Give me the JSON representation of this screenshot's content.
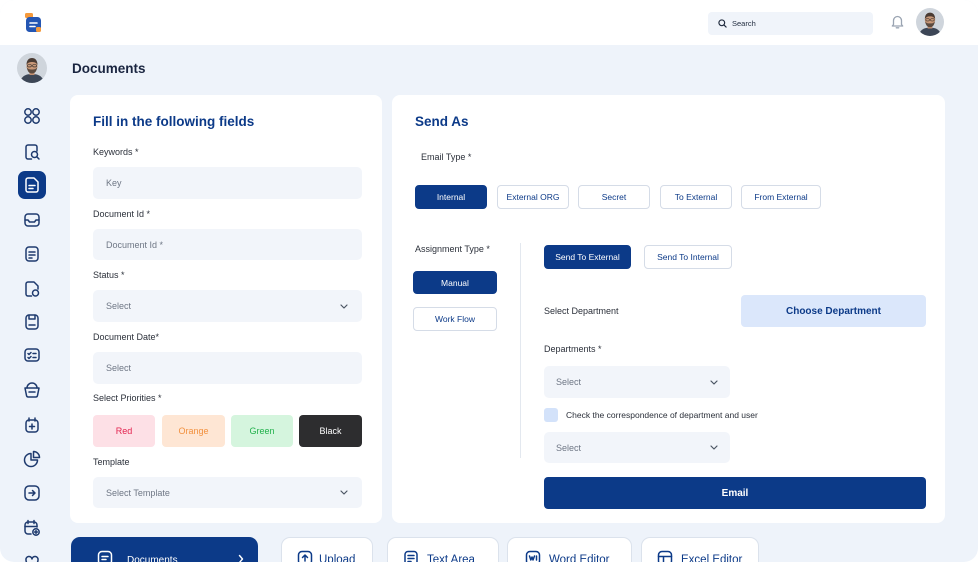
{
  "theme": {
    "primary_color": "#0c3a88",
    "page_background_color": "#eef3fa",
    "input_background_color": "#f2f5fa",
    "choose_button_color": "#dbe7fb"
  },
  "topbar": {
    "logo_icon": "app-logo-icon",
    "search": {
      "icon": "search-icon",
      "placeholder": "Search"
    },
    "notification_icon": "bell-icon"
  },
  "sidebar": {
    "items": [
      {
        "icon": "dashboard-grid-icon",
        "active": false
      },
      {
        "icon": "search-document-icon",
        "active": false
      },
      {
        "icon": "documents-icon",
        "active": true
      },
      {
        "icon": "inbox-icon",
        "active": false
      },
      {
        "icon": "notes-icon",
        "active": false
      },
      {
        "icon": "file-shapes-icon",
        "active": false
      },
      {
        "icon": "save-document-icon",
        "active": false
      },
      {
        "icon": "checklist-icon",
        "active": false
      },
      {
        "icon": "basket-icon",
        "active": false
      },
      {
        "icon": "calendar-add-icon",
        "active": false
      },
      {
        "icon": "pie-chart-icon",
        "active": false
      },
      {
        "icon": "export-icon",
        "active": false
      },
      {
        "icon": "schedule-add-icon",
        "active": false
      },
      {
        "icon": "favorites-icon",
        "active": false
      }
    ]
  },
  "page": {
    "title": "Documents"
  },
  "form_card": {
    "title": "Fill in the following fields",
    "keywords": {
      "label": "Keywords *",
      "placeholder": "Key"
    },
    "document_id": {
      "label": "Document Id *",
      "placeholder": "Document Id *"
    },
    "status": {
      "label": "Status *",
      "value": "Select"
    },
    "document_date": {
      "label": "Document Date*",
      "placeholder": "Select"
    },
    "priorities": {
      "label": "Select Priorities *",
      "options": [
        {
          "label": "Red",
          "text_color": "#e3234f",
          "background_color": "#fde0e6"
        },
        {
          "label": "Orange",
          "text_color": "#f2913f",
          "background_color": "#fee6d4"
        },
        {
          "label": "Green",
          "text_color": "#22b14c",
          "background_color": "#d5f5de"
        },
        {
          "label": "Black",
          "text_color": "#ffffff",
          "background_color": "#2d2d2f"
        }
      ]
    },
    "template": {
      "label": "Template",
      "value": "Select Template"
    }
  },
  "send_card": {
    "title": "Send As",
    "email_type": {
      "label": "Email Type *",
      "options": [
        {
          "label": "Internal",
          "active": true
        },
        {
          "label": "External ORG",
          "active": false
        },
        {
          "label": "Secret",
          "active": false
        },
        {
          "label": "To External",
          "active": false
        },
        {
          "label": "From External",
          "active": false
        }
      ]
    },
    "assignment_type": {
      "label": "Assignment Type *",
      "options": [
        {
          "label": "Manual",
          "active": true
        },
        {
          "label": "Work Flow",
          "active": false
        }
      ]
    },
    "send_to": {
      "options": [
        {
          "label": "Send To External",
          "active": true
        },
        {
          "label": "Send To Internal",
          "active": false
        }
      ]
    },
    "department_picker": {
      "label": "Select Department",
      "button_label": "Choose Department"
    },
    "departments": {
      "label": "Departments *",
      "value": "Select"
    },
    "correspondence_check": {
      "label": "Check the correspondence of department and user",
      "checked": false
    },
    "user_select": {
      "value": "Select"
    },
    "email_button_label": "Email"
  },
  "bottom_tabs": [
    {
      "label": "Documents",
      "icon": "document-icon",
      "active": true
    },
    {
      "label": "Upload",
      "icon": "upload-icon",
      "active": false
    },
    {
      "label": "Text Area",
      "icon": "text-area-icon",
      "active": false
    },
    {
      "label": "Word Editor",
      "icon": "word-editor-icon",
      "active": false
    },
    {
      "label": "Excel Editor",
      "icon": "excel-editor-icon",
      "active": false
    }
  ]
}
